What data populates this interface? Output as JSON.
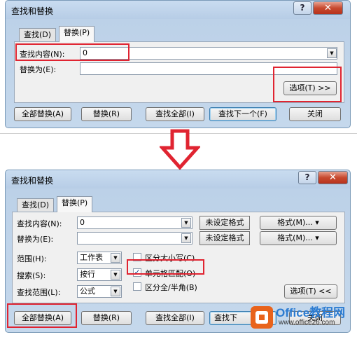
{
  "dialog_title": "查找和替换",
  "help_glyph": "?",
  "close_glyph": "✕",
  "tabs": {
    "find": "查找(D)",
    "replace": "替换(P)"
  },
  "find_label": "查找内容(N):",
  "find_value": "0",
  "replace_label": "替换为(E):",
  "replace_value": "",
  "options_expand_label": "选项(T) >>",
  "options_collapse_label": "选项(T) <<",
  "buttons": {
    "replace_all": "全部替换(A)",
    "replace": "替换(R)",
    "find_all": "查找全部(I)",
    "find_next": "查找下一个(F)",
    "find_next_cut": "查找下",
    "close": "关闭"
  },
  "format_status": "未设定格式",
  "format_button": "格式(M)...",
  "scope_label": "范围(H):",
  "scope_value": "工作表",
  "search_label": "搜索(S):",
  "search_value": "按行",
  "look_in_label": "查找范围(L):",
  "look_in_value": "公式",
  "options": {
    "match_case": "区分大小写(C)",
    "match_cell": "单元格匹配(O)",
    "match_byte": "区分全/半角(B)"
  },
  "match_cell_checked": true,
  "watermark": {
    "title": "Office教程网",
    "url": "www.office26.com"
  },
  "colors": {
    "highlight": "#e02431",
    "accent": "#3c7fb1"
  }
}
